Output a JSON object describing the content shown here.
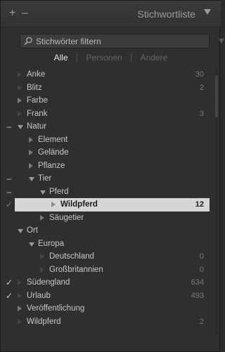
{
  "header": {
    "plus": "+",
    "minus": "–",
    "title": "Stichwortliste",
    "menu_icon": "triangle-down-icon"
  },
  "filter": {
    "placeholder": "Stichwörter filtern",
    "icon": "search-icon"
  },
  "segments": {
    "all": "Alle",
    "people": "Personen",
    "other": "Andere",
    "separator": "|"
  },
  "keywords": [
    {
      "label": "Anke",
      "count": "30",
      "mark": "",
      "expand": "leaf",
      "level": 0
    },
    {
      "label": "Blitz",
      "count": "2",
      "mark": "",
      "expand": "leaf",
      "level": 0
    },
    {
      "label": "Farbe",
      "count": "",
      "mark": "",
      "expand": "collapsed",
      "level": 0
    },
    {
      "label": "Frank",
      "count": "3",
      "mark": "",
      "expand": "leaf",
      "level": 0
    },
    {
      "label": "Natur",
      "count": "",
      "mark": "–",
      "expand": "expanded",
      "level": 0
    },
    {
      "label": "Element",
      "count": "",
      "mark": "",
      "expand": "collapsed",
      "level": 1
    },
    {
      "label": "Gelände",
      "count": "",
      "mark": "",
      "expand": "collapsed",
      "level": 1
    },
    {
      "label": "Pflanze",
      "count": "",
      "mark": "",
      "expand": "collapsed",
      "level": 1
    },
    {
      "label": "Tier",
      "count": "",
      "mark": "–",
      "expand": "expanded",
      "level": 1
    },
    {
      "label": "Pferd",
      "count": "",
      "mark": "–",
      "expand": "expanded",
      "level": 2
    },
    {
      "label": "Wildpferd",
      "count": "12",
      "mark": "✓",
      "expand": "leaf",
      "level": 3,
      "selected": true
    },
    {
      "label": "Säugetier",
      "count": "",
      "mark": "",
      "expand": "collapsed",
      "level": 2
    },
    {
      "label": "Ort",
      "count": "",
      "mark": "",
      "expand": "expanded",
      "level": 0
    },
    {
      "label": "Europa",
      "count": "",
      "mark": "",
      "expand": "expanded",
      "level": 1
    },
    {
      "label": "Deutschland",
      "count": "0",
      "mark": "",
      "expand": "leaf",
      "level": 2
    },
    {
      "label": "Großbritannien",
      "count": "0",
      "mark": "",
      "expand": "leaf",
      "level": 2
    },
    {
      "label": "Südengland",
      "count": "634",
      "mark": "✓",
      "expand": "leaf",
      "level": 0
    },
    {
      "label": "Urlaub",
      "count": "493",
      "mark": "✓",
      "expand": "leaf",
      "level": 0
    },
    {
      "label": "Veröffentlichung",
      "count": "",
      "mark": "",
      "expand": "collapsed",
      "level": 0
    },
    {
      "label": "Wildpferd",
      "count": "2",
      "mark": "",
      "expand": "leaf",
      "level": 0
    }
  ]
}
